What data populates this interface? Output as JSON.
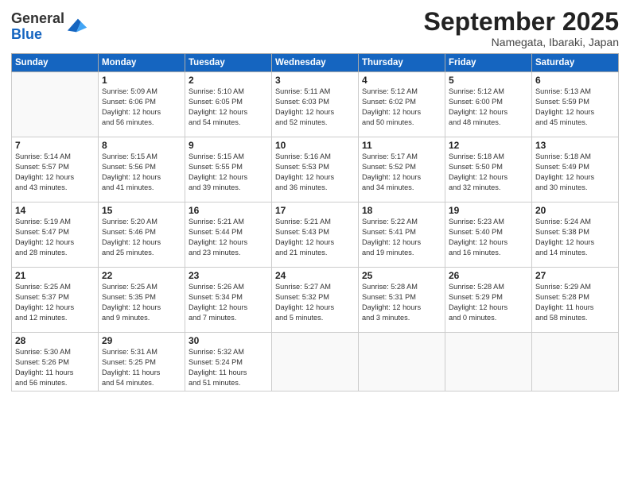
{
  "header": {
    "logo_general": "General",
    "logo_blue": "Blue",
    "month": "September 2025",
    "location": "Namegata, Ibaraki, Japan"
  },
  "weekdays": [
    "Sunday",
    "Monday",
    "Tuesday",
    "Wednesday",
    "Thursday",
    "Friday",
    "Saturday"
  ],
  "weeks": [
    [
      {
        "day": "",
        "info": ""
      },
      {
        "day": "1",
        "info": "Sunrise: 5:09 AM\nSunset: 6:06 PM\nDaylight: 12 hours\nand 56 minutes."
      },
      {
        "day": "2",
        "info": "Sunrise: 5:10 AM\nSunset: 6:05 PM\nDaylight: 12 hours\nand 54 minutes."
      },
      {
        "day": "3",
        "info": "Sunrise: 5:11 AM\nSunset: 6:03 PM\nDaylight: 12 hours\nand 52 minutes."
      },
      {
        "day": "4",
        "info": "Sunrise: 5:12 AM\nSunset: 6:02 PM\nDaylight: 12 hours\nand 50 minutes."
      },
      {
        "day": "5",
        "info": "Sunrise: 5:12 AM\nSunset: 6:00 PM\nDaylight: 12 hours\nand 48 minutes."
      },
      {
        "day": "6",
        "info": "Sunrise: 5:13 AM\nSunset: 5:59 PM\nDaylight: 12 hours\nand 45 minutes."
      }
    ],
    [
      {
        "day": "7",
        "info": "Sunrise: 5:14 AM\nSunset: 5:57 PM\nDaylight: 12 hours\nand 43 minutes."
      },
      {
        "day": "8",
        "info": "Sunrise: 5:15 AM\nSunset: 5:56 PM\nDaylight: 12 hours\nand 41 minutes."
      },
      {
        "day": "9",
        "info": "Sunrise: 5:15 AM\nSunset: 5:55 PM\nDaylight: 12 hours\nand 39 minutes."
      },
      {
        "day": "10",
        "info": "Sunrise: 5:16 AM\nSunset: 5:53 PM\nDaylight: 12 hours\nand 36 minutes."
      },
      {
        "day": "11",
        "info": "Sunrise: 5:17 AM\nSunset: 5:52 PM\nDaylight: 12 hours\nand 34 minutes."
      },
      {
        "day": "12",
        "info": "Sunrise: 5:18 AM\nSunset: 5:50 PM\nDaylight: 12 hours\nand 32 minutes."
      },
      {
        "day": "13",
        "info": "Sunrise: 5:18 AM\nSunset: 5:49 PM\nDaylight: 12 hours\nand 30 minutes."
      }
    ],
    [
      {
        "day": "14",
        "info": "Sunrise: 5:19 AM\nSunset: 5:47 PM\nDaylight: 12 hours\nand 28 minutes."
      },
      {
        "day": "15",
        "info": "Sunrise: 5:20 AM\nSunset: 5:46 PM\nDaylight: 12 hours\nand 25 minutes."
      },
      {
        "day": "16",
        "info": "Sunrise: 5:21 AM\nSunset: 5:44 PM\nDaylight: 12 hours\nand 23 minutes."
      },
      {
        "day": "17",
        "info": "Sunrise: 5:21 AM\nSunset: 5:43 PM\nDaylight: 12 hours\nand 21 minutes."
      },
      {
        "day": "18",
        "info": "Sunrise: 5:22 AM\nSunset: 5:41 PM\nDaylight: 12 hours\nand 19 minutes."
      },
      {
        "day": "19",
        "info": "Sunrise: 5:23 AM\nSunset: 5:40 PM\nDaylight: 12 hours\nand 16 minutes."
      },
      {
        "day": "20",
        "info": "Sunrise: 5:24 AM\nSunset: 5:38 PM\nDaylight: 12 hours\nand 14 minutes."
      }
    ],
    [
      {
        "day": "21",
        "info": "Sunrise: 5:25 AM\nSunset: 5:37 PM\nDaylight: 12 hours\nand 12 minutes."
      },
      {
        "day": "22",
        "info": "Sunrise: 5:25 AM\nSunset: 5:35 PM\nDaylight: 12 hours\nand 9 minutes."
      },
      {
        "day": "23",
        "info": "Sunrise: 5:26 AM\nSunset: 5:34 PM\nDaylight: 12 hours\nand 7 minutes."
      },
      {
        "day": "24",
        "info": "Sunrise: 5:27 AM\nSunset: 5:32 PM\nDaylight: 12 hours\nand 5 minutes."
      },
      {
        "day": "25",
        "info": "Sunrise: 5:28 AM\nSunset: 5:31 PM\nDaylight: 12 hours\nand 3 minutes."
      },
      {
        "day": "26",
        "info": "Sunrise: 5:28 AM\nSunset: 5:29 PM\nDaylight: 12 hours\nand 0 minutes."
      },
      {
        "day": "27",
        "info": "Sunrise: 5:29 AM\nSunset: 5:28 PM\nDaylight: 11 hours\nand 58 minutes."
      }
    ],
    [
      {
        "day": "28",
        "info": "Sunrise: 5:30 AM\nSunset: 5:26 PM\nDaylight: 11 hours\nand 56 minutes."
      },
      {
        "day": "29",
        "info": "Sunrise: 5:31 AM\nSunset: 5:25 PM\nDaylight: 11 hours\nand 54 minutes."
      },
      {
        "day": "30",
        "info": "Sunrise: 5:32 AM\nSunset: 5:24 PM\nDaylight: 11 hours\nand 51 minutes."
      },
      {
        "day": "",
        "info": ""
      },
      {
        "day": "",
        "info": ""
      },
      {
        "day": "",
        "info": ""
      },
      {
        "day": "",
        "info": ""
      }
    ]
  ]
}
